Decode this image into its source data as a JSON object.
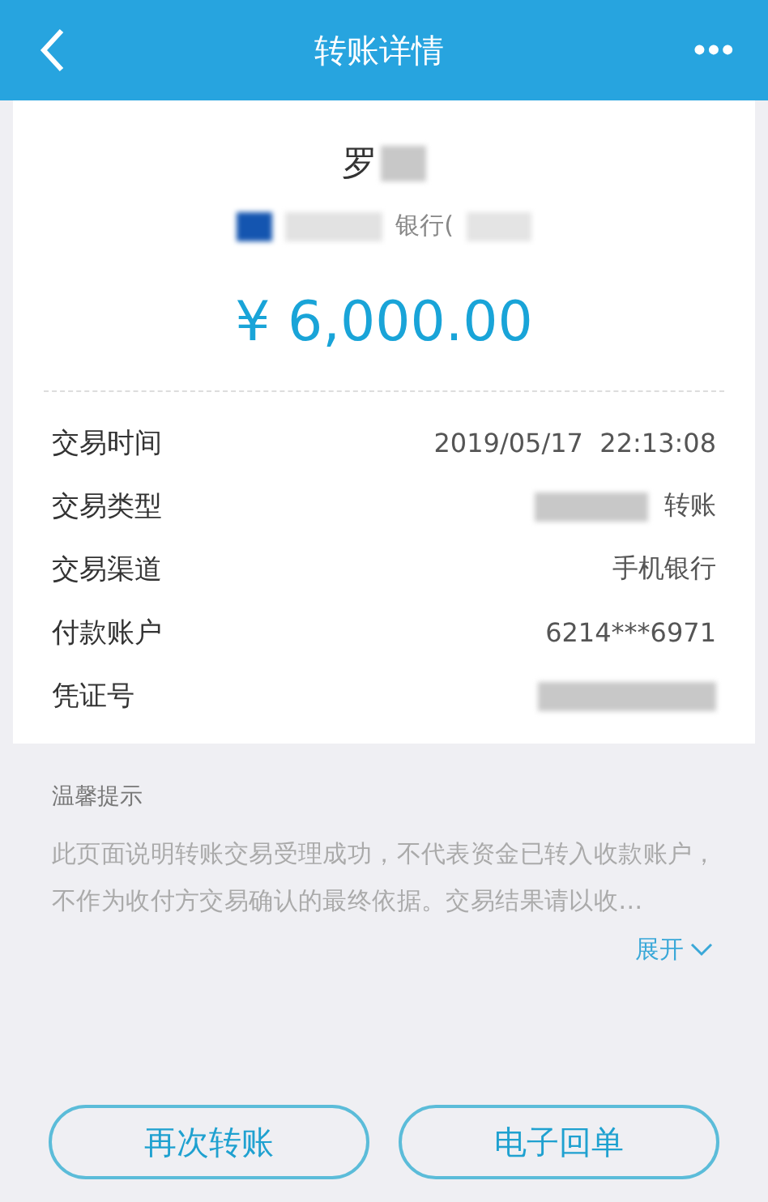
{
  "header": {
    "title": "转账详情",
    "more": "•••"
  },
  "payee": {
    "name": "罗",
    "bank": "银行("
  },
  "amount": "¥ 6,000.00",
  "details": [
    {
      "label": "交易时间",
      "value": "2019/05/17  22:13:08",
      "blurred": false
    },
    {
      "label": "交易类型",
      "value": "转账",
      "blurred": true
    },
    {
      "label": "交易渠道",
      "value": "手机银行",
      "blurred": false
    },
    {
      "label": "付款账户",
      "value": "6214***6971",
      "blurred": false
    },
    {
      "label": "凭证号",
      "blurred": true
    }
  ],
  "notice": {
    "title": "温馨提示",
    "text": "此页面说明转账交易受理成功，不代表资金已转入收款账户，不作为收付方交易确认的最终依据。交易结果请以收…",
    "toggle": "展开",
    "expanded": false
  },
  "buttons": [
    "再次转账",
    "电子回单"
  ]
}
